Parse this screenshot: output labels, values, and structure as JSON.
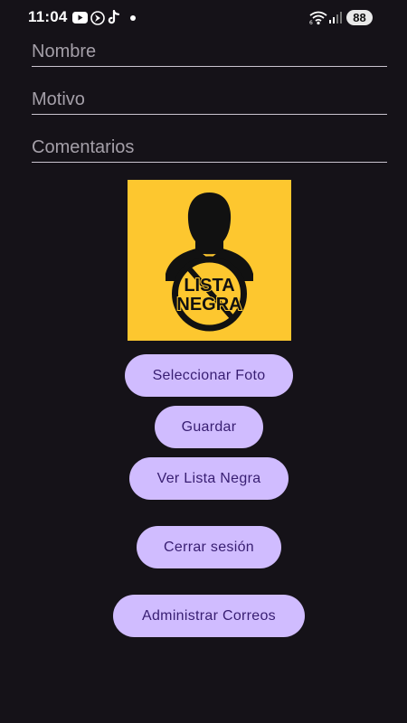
{
  "status_bar": {
    "time": "11:04",
    "battery": "88",
    "icons": [
      "youtube-icon",
      "navigation-icon",
      "tiktok-icon",
      "notification-dot-icon",
      "wifi-icon",
      "signal-icon"
    ]
  },
  "form": {
    "nombre_placeholder": "Nombre",
    "motivo_placeholder": "Motivo",
    "comentarios_placeholder": "Comentarios"
  },
  "photo": {
    "line1": "LISTA",
    "line2": "NEGRA",
    "background": "#fdc72f"
  },
  "buttons": {
    "select_photo": "Seleccionar Foto",
    "save": "Guardar",
    "view_blacklist": "Ver Lista Negra",
    "logout": "Cerrar sesión",
    "manage_emails": "Administrar Correos"
  },
  "colors": {
    "background": "#151218",
    "button_bg": "#d0bcff",
    "button_text": "#381e72",
    "field_underline": "#cac4cf"
  }
}
